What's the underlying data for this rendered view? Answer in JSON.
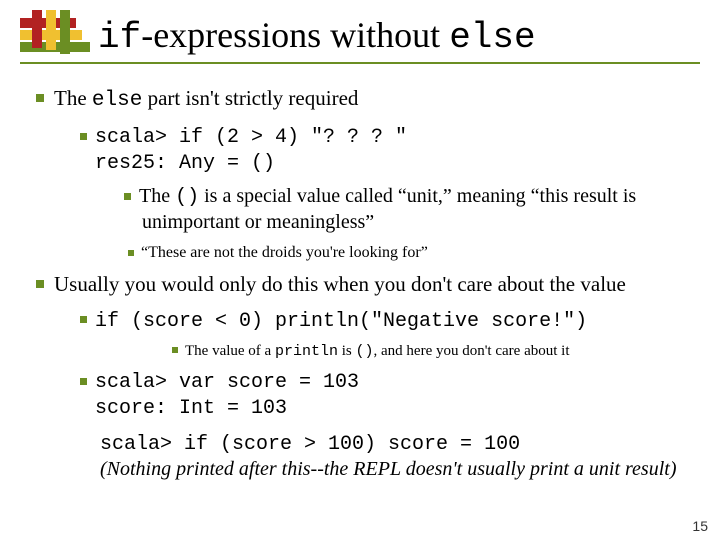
{
  "title_pre": "if",
  "title_mid": "-expressions without ",
  "title_post": "else",
  "b1_pre": "The ",
  "b1_mono": "else",
  "b1_post": " part isn't strictly required",
  "code1_a": "scala> if (2 > 4) \"? ? ? \"",
  "code1_b": "res25: Any = ()",
  "b2_pre": "The ",
  "b2_mono": "()",
  "b2_post": " is a special value called “unit,” meaning “this result is unimportant or meaningless”",
  "b3": "“These are not the droids you're looking for”",
  "b4": "Usually you would only do this when you don't care about the value",
  "code2": "if (score < 0) println(\"Negative score!\")",
  "b5_pre": "The value of a ",
  "b5_mono1": "println",
  "b5_mid": " is ",
  "b5_mono2": "()",
  "b5_post": ", and here you don't care about it",
  "code3_a": "scala> var score = 103",
  "code3_b": "score: Int = 103",
  "code4": "scala> if (score > 100) score = 100",
  "note": "(Nothing printed after this--the REPL doesn't usually print a unit result)",
  "pagenum": "15"
}
